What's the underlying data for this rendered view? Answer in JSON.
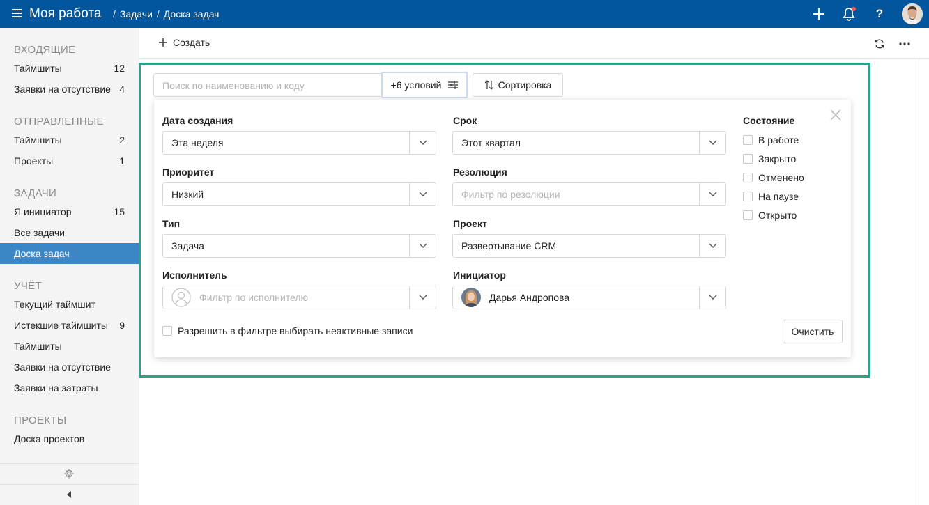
{
  "header": {
    "app_title": "Моя работа",
    "breadcrumbs": [
      "Задачи",
      "Доска задач"
    ],
    "help_label": "?",
    "icons": [
      "menu-icon",
      "plus-icon",
      "bell-icon",
      "help-icon",
      "avatar"
    ]
  },
  "sidebar": {
    "sections": [
      {
        "title": "ВХОДЯЩИЕ",
        "items": [
          {
            "label": "Таймшиты",
            "count": "12"
          },
          {
            "label": "Заявки на отсутствие",
            "count": "4"
          }
        ]
      },
      {
        "title": "ОТПРАВЛЕННЫЕ",
        "items": [
          {
            "label": "Таймшиты",
            "count": "2"
          },
          {
            "label": "Проекты",
            "count": "1"
          }
        ]
      },
      {
        "title": "ЗАДАЧИ",
        "items": [
          {
            "label": "Я инициатор",
            "count": "15"
          },
          {
            "label": "Все задачи",
            "count": ""
          },
          {
            "label": "Доска задач",
            "count": "",
            "active": true
          }
        ]
      },
      {
        "title": "УЧЁТ",
        "items": [
          {
            "label": "Текущий таймшит",
            "count": ""
          },
          {
            "label": "Истекшие таймшиты",
            "count": "9"
          },
          {
            "label": "Таймшиты",
            "count": ""
          },
          {
            "label": "Заявки на отсутствие",
            "count": ""
          },
          {
            "label": "Заявки на затраты",
            "count": ""
          }
        ]
      },
      {
        "title": "ПРОЕКТЫ",
        "items": [
          {
            "label": "Доска проектов",
            "count": ""
          }
        ]
      }
    ]
  },
  "toolbar": {
    "create_label": "Создать"
  },
  "filters": {
    "search_placeholder": "Поиск по наименованию и коду",
    "conditions_label": "+6 условий",
    "sort_label": "Сортировка",
    "fields": {
      "created": {
        "label": "Дата создания",
        "value": "Эта неделя"
      },
      "due": {
        "label": "Срок",
        "value": "Этот квартал"
      },
      "priority": {
        "label": "Приоритет",
        "value": "Низкий"
      },
      "resolution": {
        "label": "Резолюция",
        "placeholder": "Фильтр по резолюции"
      },
      "type": {
        "label": "Тип",
        "value": "Задача"
      },
      "project": {
        "label": "Проект",
        "value": "Развертывание CRM"
      },
      "assignee": {
        "label": "Исполнитель",
        "placeholder": "Фильтр по исполнителю"
      },
      "initiator": {
        "label": "Инициатор",
        "value": "Дарья Андропова"
      }
    },
    "state": {
      "title": "Состояние",
      "options": [
        "В работе",
        "Закрыто",
        "Отменено",
        "На паузе",
        "Открыто"
      ]
    },
    "inactive_label": "Разрешить в фильтре выбирать неактивные записи",
    "clear_label": "Очистить"
  },
  "colors": {
    "header_bg": "#02569d",
    "sidebar_active": "#3d86c6",
    "frame": "#2aa58c",
    "notification_dot": "#ff5a5a"
  }
}
